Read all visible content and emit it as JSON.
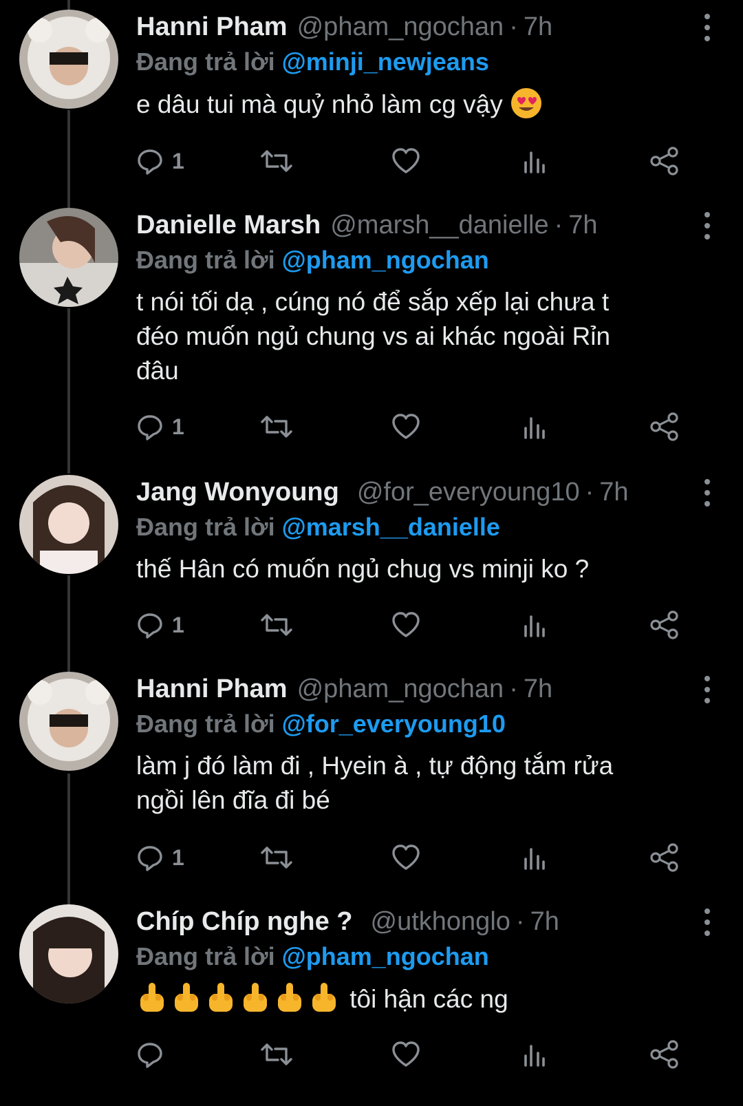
{
  "reply_prefix": "Đang trả lời",
  "tweets": [
    {
      "name": "Hanni Pham",
      "handle": "@pham_ngochan",
      "time": "7h",
      "reply_to": "@minji_newjeans",
      "text": "e dâu tui mà quỷ nhỏ làm cg vậy",
      "emoji": "smiling-face-with-heart-eyes",
      "reply_count": "1"
    },
    {
      "name": "Danielle Marsh",
      "handle": "@marsh__danielle",
      "time": "7h",
      "reply_to": "@pham_ngochan",
      "text": "t nói tối dạ , cúng nó để sắp xếp lại chưa t\nđéo muốn ngủ chung vs ai khác ngoài Rỉn\nđâu",
      "reply_count": "1"
    },
    {
      "name": "Jang Wonyoung",
      "handle": "@for_everyoung10",
      "time": "7h",
      "reply_to": "@marsh__danielle",
      "text": "thế Hân có muốn ngủ chug vs minji ko ?",
      "reply_count": "1"
    },
    {
      "name": "Hanni Pham",
      "handle": "@pham_ngochan",
      "time": "7h",
      "reply_to": "@for_everyoung10",
      "text": "làm j đó làm đi , Hyein à , tự động tắm rửa\nngồi lên đĩa đi bé",
      "reply_count": "1"
    },
    {
      "name": "Chíp Chíp nghe ?",
      "handle": "@utkhonglo",
      "time": "7h",
      "reply_to": "@pham_ngochan",
      "text": "tôi hận các ng",
      "emoji": "middle-finger x6",
      "reply_count": ""
    }
  ],
  "icons": [
    "reply-icon",
    "retweet-icon",
    "like-icon",
    "views-icon",
    "share-icon",
    "more-icon"
  ],
  "colors": {
    "background": "#000000",
    "mention": "#1d9bf0",
    "muted": "#71767b",
    "text": "#e7e9ea"
  }
}
